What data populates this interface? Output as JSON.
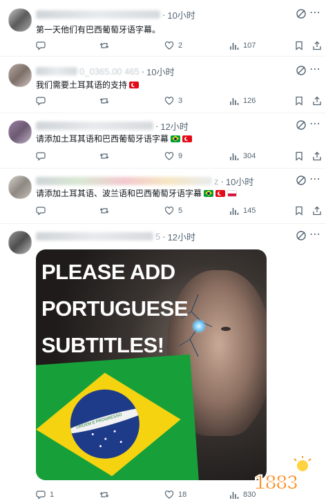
{
  "tweets": [
    {
      "time": "10小时",
      "text": "第一天他们有巴西葡萄牙语字幕。",
      "flags": [],
      "reply": "",
      "repost": "",
      "like": "2",
      "views": "107"
    },
    {
      "time": "10小时",
      "text": "我们需要土耳其语的支持",
      "flags": [
        "tr"
      ],
      "reply": "",
      "repost": "",
      "like": "3",
      "views": "126"
    },
    {
      "time": "12小时",
      "text": "请添加土耳其语和巴西葡萄牙语字幕",
      "flags": [
        "br",
        "tr"
      ],
      "reply": "",
      "repost": "",
      "like": "9",
      "views": "304"
    },
    {
      "time": "10小时",
      "text": "请添加土耳其语、波兰语和巴西葡萄牙语字幕",
      "flags": [
        "br",
        "tr",
        "pl"
      ],
      "reply": "",
      "repost": "",
      "like": "5",
      "views": "145"
    },
    {
      "time": "12小时",
      "text": "",
      "flags": [],
      "reply": "1",
      "repost": "",
      "like": "18",
      "views": "830"
    }
  ],
  "header_fragments": {
    "tweet2_handle_tail": "0_0365.00 465",
    "tweet4_handle_tail": "z",
    "tweet5_handle_tail": "5"
  },
  "media": {
    "headline": [
      "PLEASE ADD",
      "PORTUGUESE",
      "SUBTITLES!"
    ],
    "flag_motto": "ORDEM E PROGRESSO"
  },
  "watermark": "1883",
  "icons": [
    "reply-icon",
    "repost-icon",
    "like-icon",
    "views-icon",
    "bookmark-icon",
    "share-icon",
    "grok-icon",
    "more-icon"
  ],
  "colors": {
    "muted": "#536471",
    "text": "#0f1419",
    "divider": "#eff3f4"
  }
}
